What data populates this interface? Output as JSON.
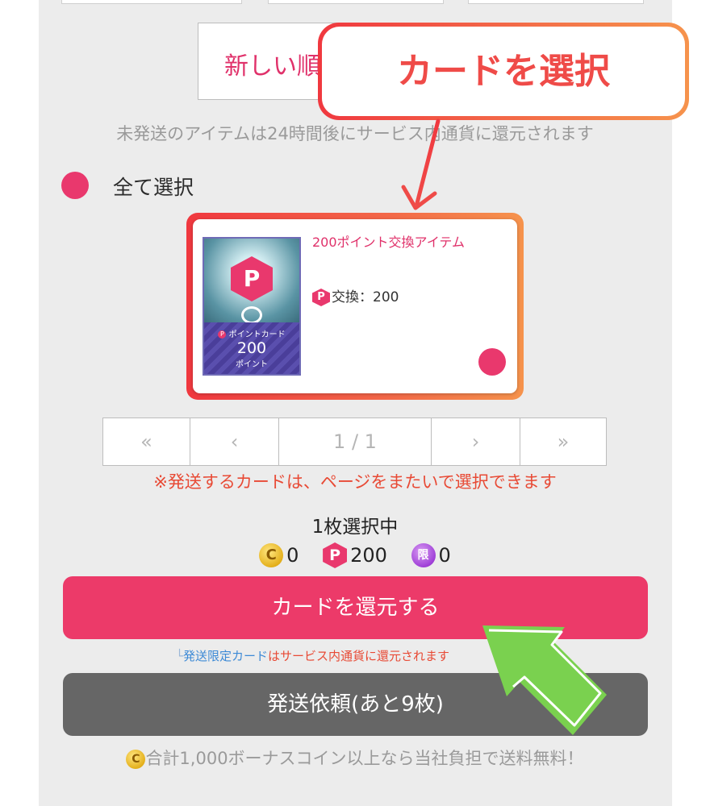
{
  "sort": {
    "label": "新しい順"
  },
  "notice": "未発送のアイテムは24時間後にサービス内通貨に還元されます",
  "select_all": {
    "label": "全て選択"
  },
  "card": {
    "name": "200ポイント交換アイテム",
    "exchange_label": "交換：200",
    "exchange_icon": "P",
    "thumb_icon": "P",
    "thumb_title": "ポイントカード",
    "thumb_value": "200",
    "thumb_unit": "ポイント"
  },
  "callout": {
    "text": "カードを選択"
  },
  "pagination": {
    "first": "«",
    "prev": "‹",
    "info": "1 / 1",
    "next": "›",
    "last": "»"
  },
  "cross_page_note": "※発送するカードは、ページをまたいで選択できます",
  "selected_count": "1枚選択中",
  "currencies": {
    "coin_icon": "C",
    "coin_value": "0",
    "point_icon": "P",
    "point_value": "200",
    "limited_icon": "限",
    "limited_value": "0"
  },
  "buttons": {
    "return_label": "カードを還元する",
    "ship_label": "発送依頼(あと9枚)"
  },
  "limit_note": {
    "corner": "└",
    "link_text": "発送限定カード",
    "rest": "はサービス内通貨に還元されます"
  },
  "free_shipping_note": "合計1,000ボーナスコイン以上なら当社負担で送料無料！",
  "colors": {
    "accent": "#ec3a69",
    "callout": "#ef4b48",
    "callout_gradient_end": "#f6934c",
    "ship_button": "#666666",
    "pointer_arrow": "#7ad14f"
  }
}
